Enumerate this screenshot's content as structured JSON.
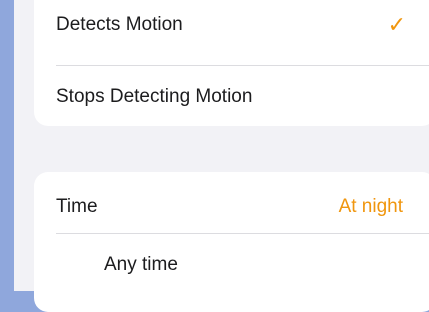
{
  "trigger_options": {
    "items": [
      {
        "label": "Detects Motion",
        "selected": true
      },
      {
        "label": "Stops Detecting Motion",
        "selected": false
      }
    ],
    "checkmark": "✓"
  },
  "time_section": {
    "label": "Time",
    "value": "At night",
    "options": [
      {
        "label": "Any time"
      }
    ]
  },
  "colors": {
    "accent": "#f0960e",
    "background": "#f2f2f6",
    "desktop": "#8fa7dc"
  }
}
